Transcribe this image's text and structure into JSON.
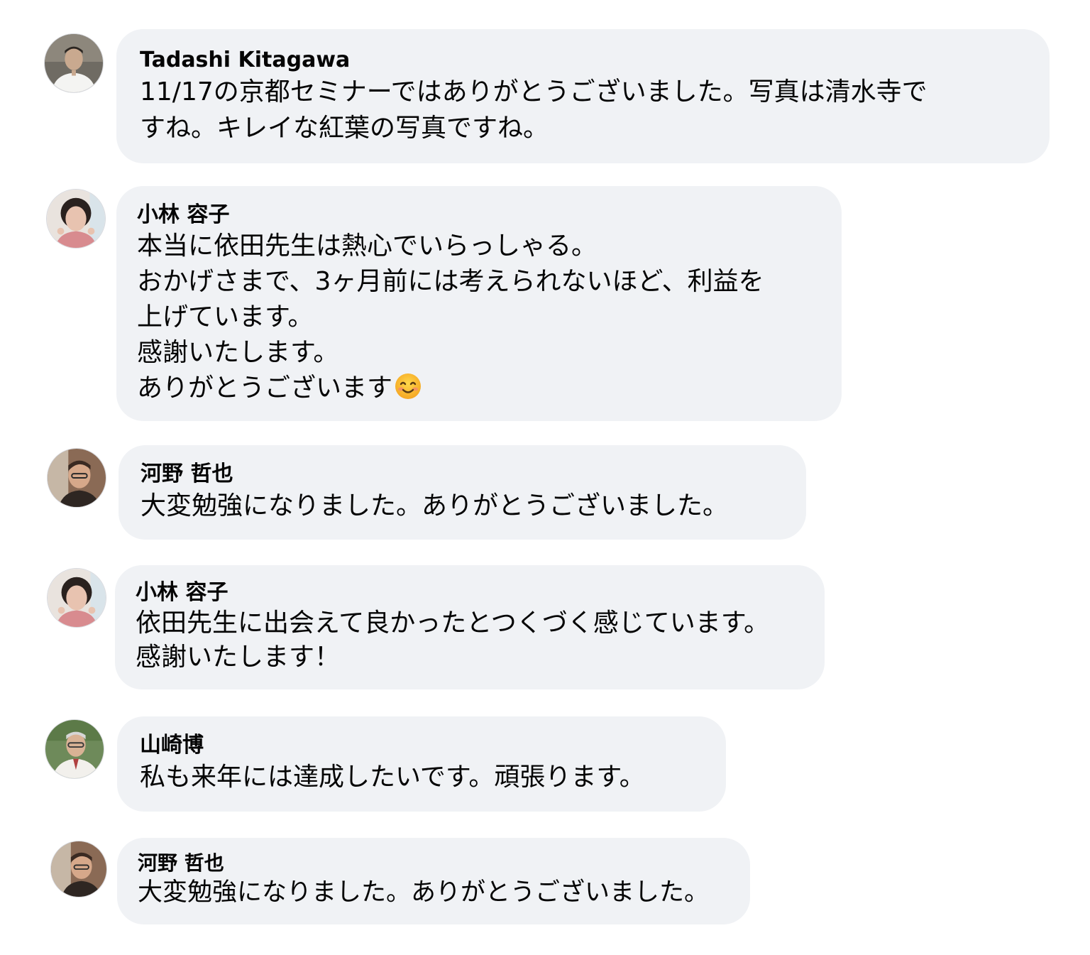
{
  "comments": [
    {
      "author": "Tadashi Kitagawa",
      "lines": [
        "11/17の京都セミナーではありがとうございました。写真は清水寺で",
        "すね。キレイな紅葉の写真ですね。"
      ]
    },
    {
      "author": "小林 容子",
      "lines": [
        "本当に依田先生は熱心でいらっしゃる。",
        "おかげさまで、3ヶ月前には考えられないほど、利益を",
        "上げています。",
        "感謝いたします。",
        "ありがとうございます"
      ],
      "emoji": "smiling-face-emoji"
    },
    {
      "author": "河野 哲也",
      "lines": [
        "大変勉強になりました。ありがとうございました。"
      ]
    },
    {
      "author": "小林 容子",
      "lines": [
        "依田先生に出会えて良かったとつくづく感じています。",
        "感謝いたします！"
      ]
    },
    {
      "author": "山崎博",
      "lines": [
        "私も来年には達成したいです。頑張ります。"
      ]
    },
    {
      "author": "河野 哲也",
      "lines": [
        "大変勉強になりました。ありがとうございました。"
      ]
    }
  ],
  "colors": {
    "bubble": "#f0f2f5",
    "text": "#050505",
    "page_background": "#ffffff"
  }
}
